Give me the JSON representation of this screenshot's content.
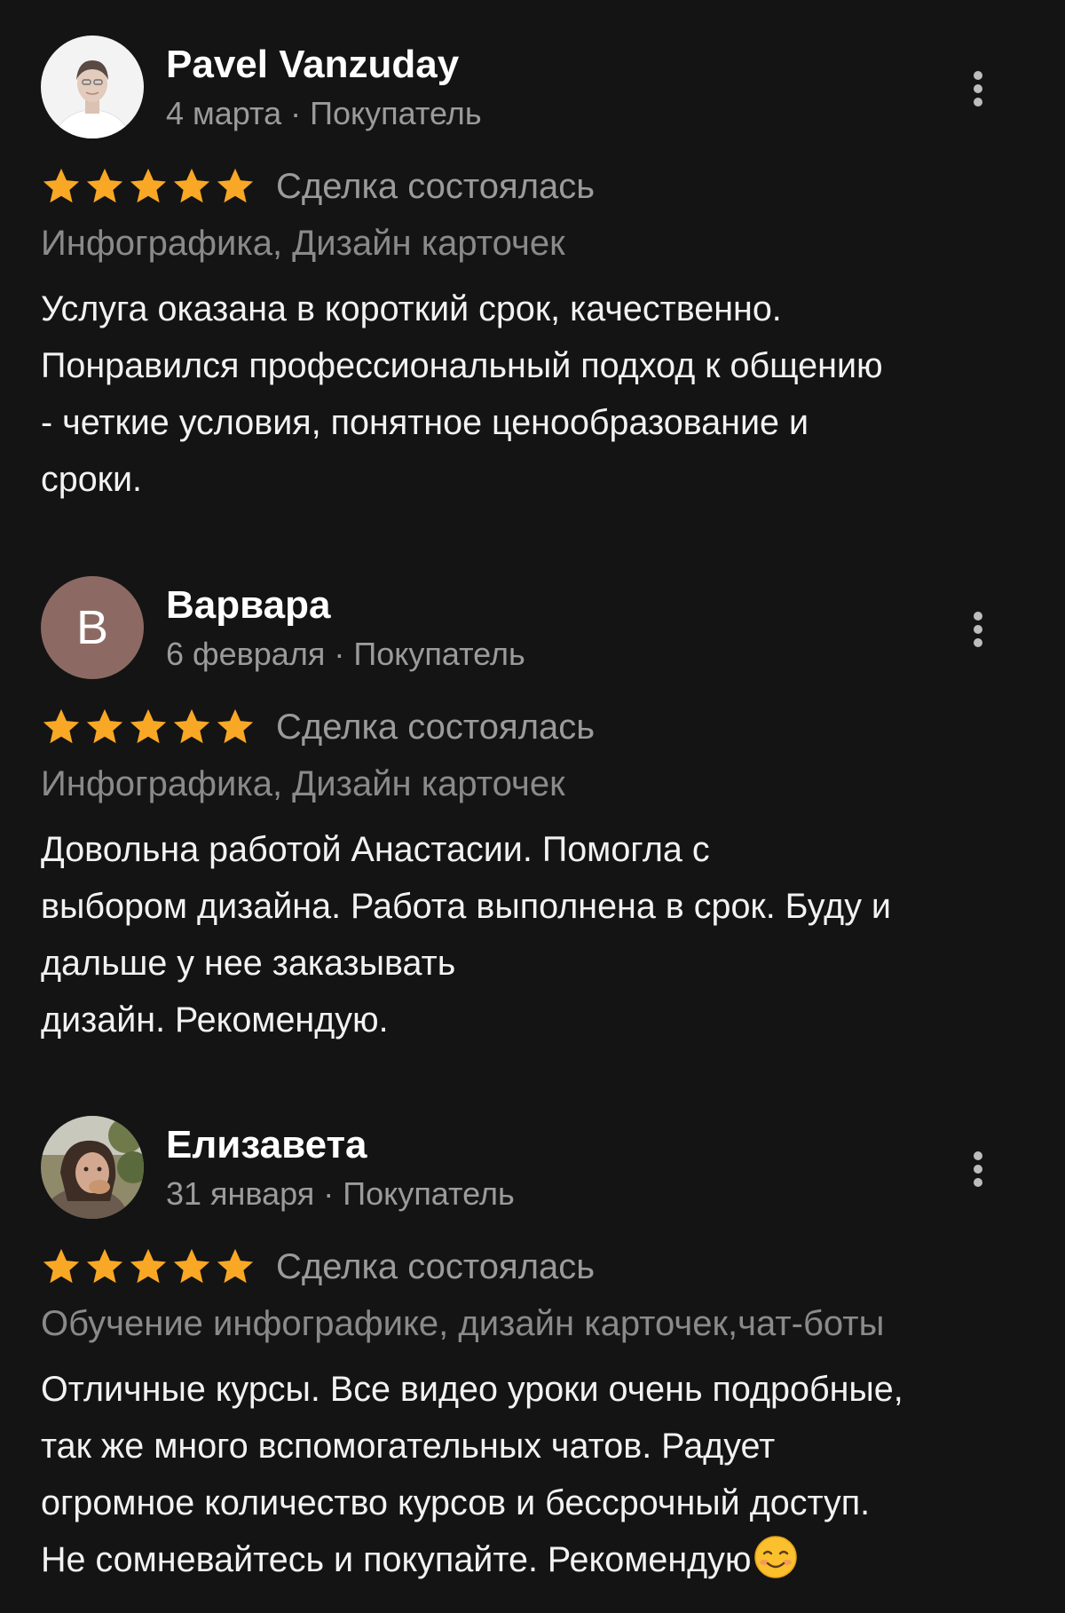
{
  "reviews": [
    {
      "author": "Pavel Vanzuday",
      "date": "4 марта",
      "role": "Покупатель",
      "meta": "4 марта · Покупатель",
      "avatar": {
        "kind": "photo",
        "icon": "avatar-photo-icon"
      },
      "rating": 5,
      "deal_status": "Сделка состоялась",
      "category": "Инфографика, Дизайн карточек",
      "text": "Услуга оказана в короткий срок, качественно.\nПонравился профессиональный подход к  общению\n- четкие условия, понятное ценообразование и\nсроки."
    },
    {
      "author": "Варвара",
      "date": "6 февраля",
      "role": "Покупатель",
      "meta": "6 февраля · Покупатель",
      "avatar": {
        "kind": "letter",
        "letter": "В",
        "color": "#8c6a63"
      },
      "rating": 5,
      "deal_status": "Сделка состоялась",
      "category": "Инфографика, Дизайн карточек",
      "text": "Довольна работой Анастасии. Помогла с\nвыбором дизайна. Работа выполнена  в срок. Буду и\nдальше у нее заказывать\nдизайн. Рекомендую."
    },
    {
      "author": "Елизавета",
      "date": "31 января",
      "role": "Покупатель",
      "meta": "31 января · Покупатель",
      "avatar": {
        "kind": "photo",
        "icon": "avatar-photo-icon"
      },
      "rating": 5,
      "deal_status": "Сделка состоялась",
      "category": "Обучение инфографике, дизайн карточек,чат-боты",
      "text": "Отличные курсы. Все видео уроки очень подробные,\nтак же много вспомогательных чатов. Радует\nогромное количество курсов и бессрочный доступ.\nНе сомневайтесь и покупайте. Рекомендую",
      "emoji": "smiling-face-emoji"
    }
  ],
  "colors": {
    "background": "#141414",
    "star": "#f9a825",
    "secondary_text": "#9b9b9b",
    "category_text": "#8a8a8a",
    "body_text": "#f2f2f2",
    "menu_icon": "#bdbdbd"
  },
  "icons": {
    "more": "more-vertical-icon",
    "star": "star-icon"
  }
}
